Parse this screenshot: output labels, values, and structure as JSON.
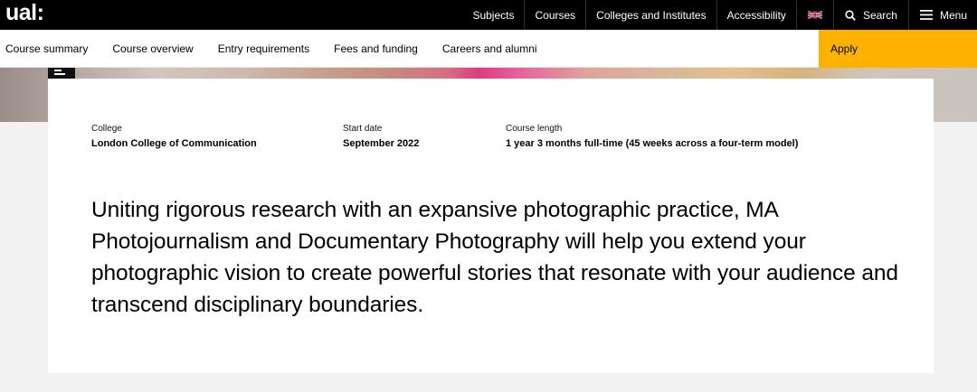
{
  "header": {
    "logo_text": "ual:",
    "nav": [
      {
        "label": "Subjects"
      },
      {
        "label": "Courses"
      },
      {
        "label": "Colleges and Institutes"
      },
      {
        "label": "Accessibility"
      }
    ],
    "language_icon": "uk-flag-icon",
    "search_label": "Search",
    "menu_label": "Menu"
  },
  "subnav": {
    "items": [
      {
        "label": "Course summary"
      },
      {
        "label": "Course overview"
      },
      {
        "label": "Entry requirements"
      },
      {
        "label": "Fees and funding"
      },
      {
        "label": "Careers and alumni"
      }
    ],
    "apply_label": "Apply"
  },
  "facts": [
    {
      "label": "College",
      "value": "London College of Communication"
    },
    {
      "label": "Start date",
      "value": "September 2022"
    },
    {
      "label": "Course length",
      "value": "1 year 3 months full-time (45 weeks across a four-term model)"
    }
  ],
  "intro": "Uniting rigorous research with an expansive photographic practice, MA Photojournalism and Documentary Photography will help you extend your photographic vision to create powerful stories that resonate with your audience and transcend disciplinary boundaries.",
  "colors": {
    "topbar": "#000000",
    "apply": "#ffb100",
    "page_bg": "#f2f2f2"
  }
}
